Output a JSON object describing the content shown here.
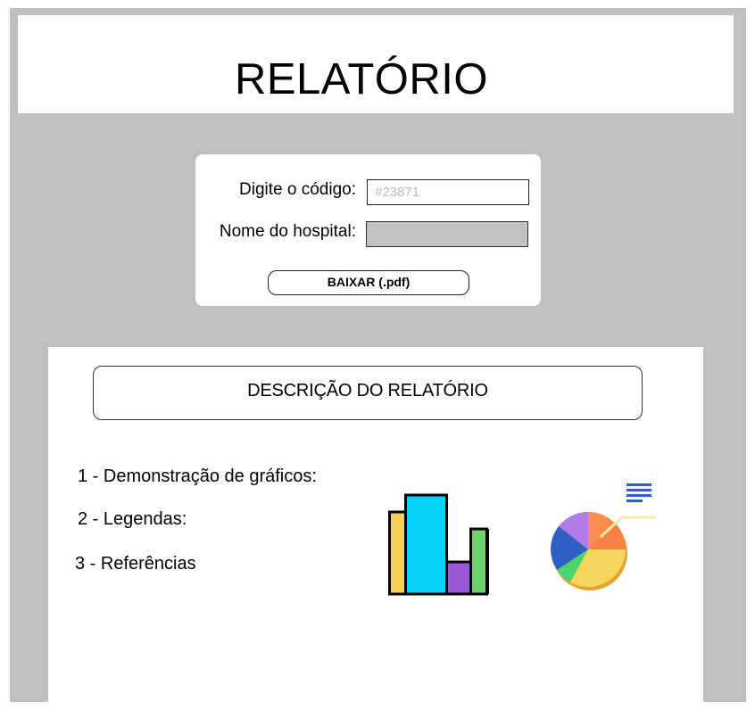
{
  "header": {
    "title": "RELATÓRIO"
  },
  "form": {
    "code_label": "Digite o código:",
    "code_placeholder": "#23871",
    "code_value": "",
    "hospital_label": "Nome do hospital:",
    "hospital_value": "",
    "download_label": "BAIXAR (.pdf)"
  },
  "report": {
    "description_title": "DESCRIÇÃO DO RELATÓRIO",
    "items": [
      "1 - Demonstração de gráficos:",
      "2 - Legendas:",
      "3 - Referências"
    ],
    "icons": [
      "bar-chart-icon",
      "pie-chart-icon"
    ]
  },
  "colors": {
    "background": "#bfbfbf",
    "panel": "#ffffff",
    "hospital_field": "#c2c2c2",
    "bar_yellow": "#f5d15c",
    "bar_cyan": "#06d2f5",
    "bar_purple": "#9b59d9",
    "bar_green": "#6fd36b",
    "pie_orange": "#fb8c4a",
    "pie_yellow": "#f6d55c",
    "pie_green": "#4dd36d",
    "pie_blue": "#2f5ec4",
    "pie_lilac": "#b07be8",
    "legend_blue": "#2f5ec4"
  }
}
